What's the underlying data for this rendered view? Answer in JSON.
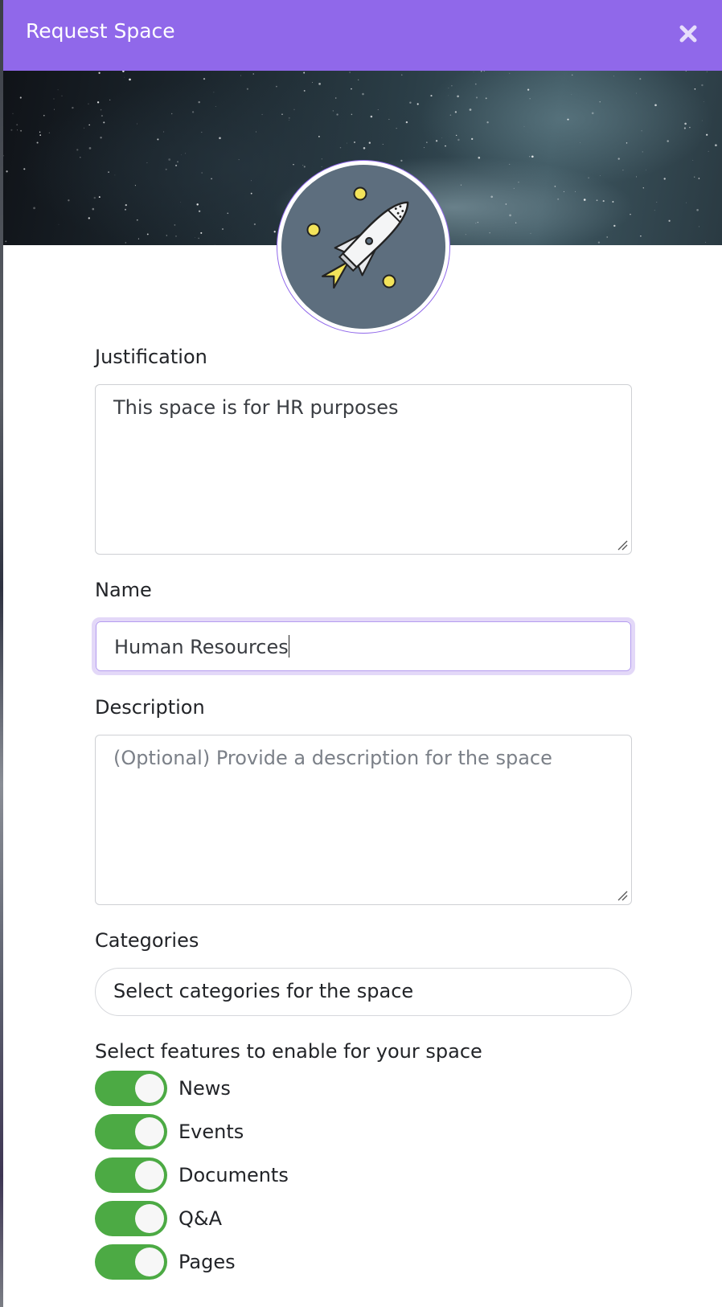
{
  "modal": {
    "title": "Request Space",
    "close_icon": "close-icon",
    "banner_image": "starry-sky-banner",
    "avatar_icon": "rocket-icon",
    "colors": {
      "header": "#9068ea",
      "toggle_on": "#4caa44",
      "avatar_bg": "#5d6e7e",
      "focus_ring": "#e3d8f8"
    }
  },
  "form": {
    "justification": {
      "label": "Justification",
      "value": "This space is for HR purposes"
    },
    "name": {
      "label": "Name",
      "value": "Human Resources"
    },
    "description": {
      "label": "Description",
      "placeholder": "(Optional) Provide a description for the space",
      "value": ""
    },
    "categories": {
      "label": "Categories",
      "placeholder": "Select categories for the space"
    },
    "features": {
      "label": "Select features to enable for your space",
      "items": [
        {
          "label": "News",
          "enabled": true
        },
        {
          "label": "Events",
          "enabled": true
        },
        {
          "label": "Documents",
          "enabled": true
        },
        {
          "label": "Q&A",
          "enabled": true
        },
        {
          "label": "Pages",
          "enabled": true
        }
      ]
    }
  }
}
